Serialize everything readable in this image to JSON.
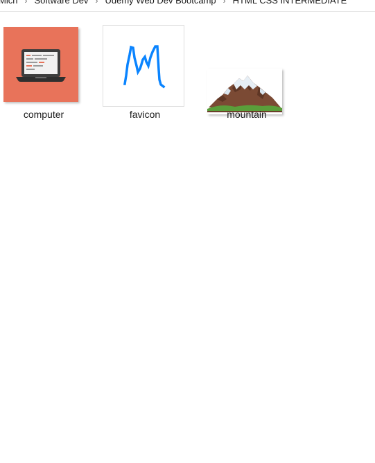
{
  "breadcrumb": {
    "items": [
      "Mich",
      "Software Dev",
      "Udemy Web Dev Bootcamp",
      "HTML CSS INTERMEDIATE"
    ],
    "separator": "›"
  },
  "files": [
    {
      "name": "computer",
      "icon": "laptop-image-icon",
      "bg_color": "#e8735a"
    },
    {
      "name": "favicon",
      "icon": "letter-m-favicon-icon",
      "stroke_color": "#0a84ff"
    },
    {
      "name": "mountain",
      "icon": "mountain-image-icon",
      "grass_color": "#5a9e3a"
    }
  ]
}
